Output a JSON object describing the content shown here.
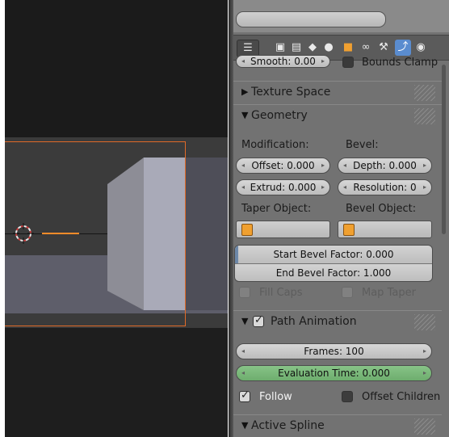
{
  "viewport": {},
  "properties": {
    "smooth_label": "Smooth: 0.00",
    "bounds_clamp_label": "Bounds Clamp",
    "tabs": [
      {
        "icon": "render-icon"
      },
      {
        "icon": "render-layers-icon"
      },
      {
        "icon": "scene-icon"
      },
      {
        "icon": "world-icon"
      },
      {
        "icon": "object-icon"
      },
      {
        "icon": "constraints-icon"
      },
      {
        "icon": "modifiers-icon"
      },
      {
        "icon": "curve-data-icon",
        "active": true
      },
      {
        "icon": "material-icon"
      }
    ],
    "texture_space": {
      "title": "Texture Space"
    },
    "geometry": {
      "title": "Geometry",
      "modification_label": "Modification:",
      "bevel_label": "Bevel:",
      "offset": "Offset: 0.000",
      "depth": "Depth: 0.000",
      "extrude": "Extrud: 0.000",
      "resolution": "Resolution: 0",
      "taper_object_label": "Taper Object:",
      "bevel_object_label": "Bevel Object:",
      "start_bevel_factor": "Start Bevel Factor: 0.000",
      "end_bevel_factor": "End Bevel Factor: 1.000",
      "fill_caps": "Fill Caps",
      "map_taper": "Map Taper"
    },
    "path_animation": {
      "title": "Path Animation",
      "enabled": true,
      "frames": "Frames: 100",
      "evaluation_time": "Evaluation Time: 0.000",
      "follow": "Follow",
      "follow_checked": true,
      "offset_children": "Offset Children",
      "offset_children_checked": false
    },
    "active_spline": {
      "title": "Active Spline"
    }
  },
  "colors": {
    "selection_outline": "#e06a28",
    "active_tab": "#5a8ccf",
    "evaluation_field": "#7bb77b"
  }
}
